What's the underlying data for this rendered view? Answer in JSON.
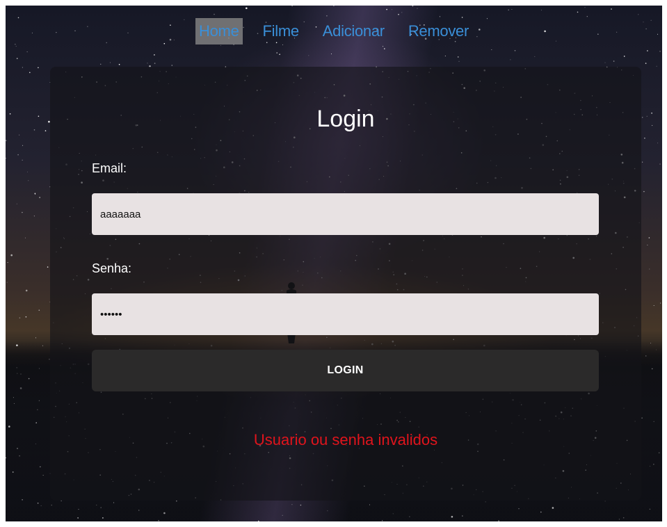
{
  "nav": {
    "items": [
      {
        "label": "Home"
      },
      {
        "label": "Filme"
      },
      {
        "label": "Adicionar"
      },
      {
        "label": "Remover"
      }
    ]
  },
  "login": {
    "title": "Login",
    "email_label": "Email:",
    "email_value": "aaaaaaa",
    "password_label": "Senha:",
    "password_value": "aaaaaa",
    "button_label": "LOGIN",
    "error_message": "Usuario ou senha invalidos"
  },
  "colors": {
    "nav_link": "#3a8fd8",
    "active_nav_bg": "#808080",
    "input_bg": "#e8e2e3",
    "button_bg": "#2b2a2a",
    "error_text": "#e0141c"
  }
}
